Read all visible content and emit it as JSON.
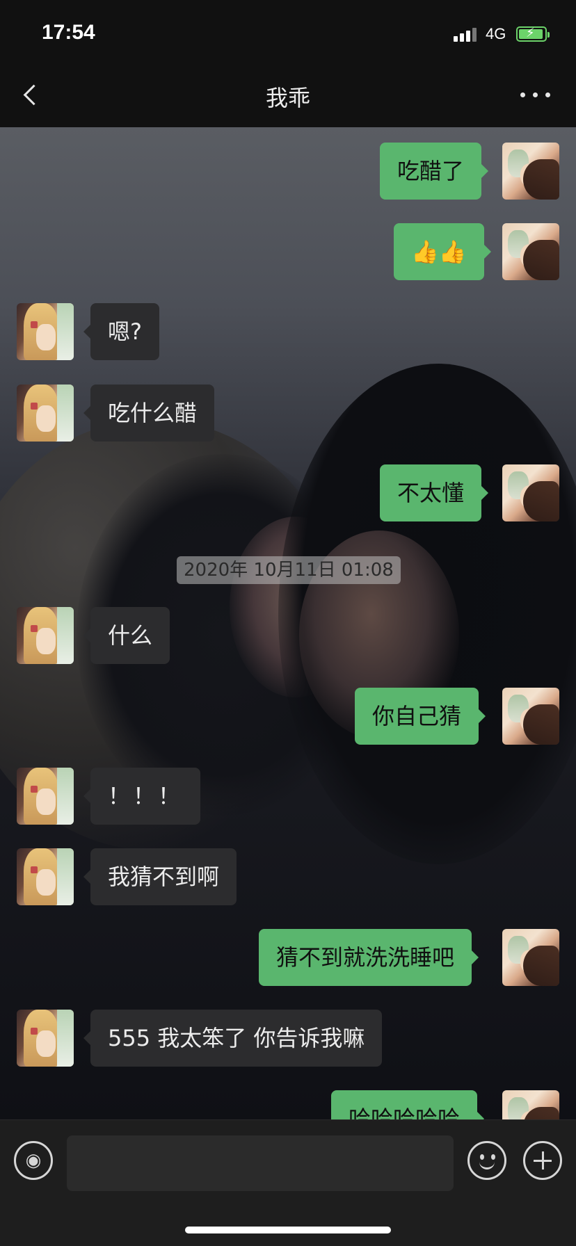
{
  "status_bar": {
    "time": "17:54",
    "network": "4G",
    "battery_charging": true,
    "accent_color": "#6cd36a"
  },
  "nav": {
    "back_icon": "chevron-left-icon",
    "title": "我乖",
    "more_icon": "more-dots-icon"
  },
  "colors": {
    "self_bubble": "#5ab66e",
    "other_bubble": "#2c2c2e",
    "background": "#111111"
  },
  "timestamp": "2020年 10月11日 01:08",
  "messages": [
    {
      "side": "self",
      "text": "吃醋了"
    },
    {
      "side": "self",
      "text": "👍👍"
    },
    {
      "side": "other",
      "text": "嗯?"
    },
    {
      "side": "other",
      "text": "吃什么醋"
    },
    {
      "side": "self",
      "text": "不太懂"
    },
    {
      "side": "other",
      "text": "什么"
    },
    {
      "side": "self",
      "text": "你自己猜"
    },
    {
      "side": "other",
      "text": "！！！"
    },
    {
      "side": "other",
      "text": "我猜不到啊"
    },
    {
      "side": "self",
      "text": "猜不到就洗洗睡吧"
    },
    {
      "side": "other",
      "text": "555 我太笨了 你告诉我嘛"
    },
    {
      "side": "self",
      "text": "哈哈哈哈哈"
    }
  ],
  "input_bar": {
    "voice_icon": "voice-icon",
    "input_value": "",
    "emoji_icon": "emoji-icon",
    "plus_icon": "plus-icon"
  }
}
